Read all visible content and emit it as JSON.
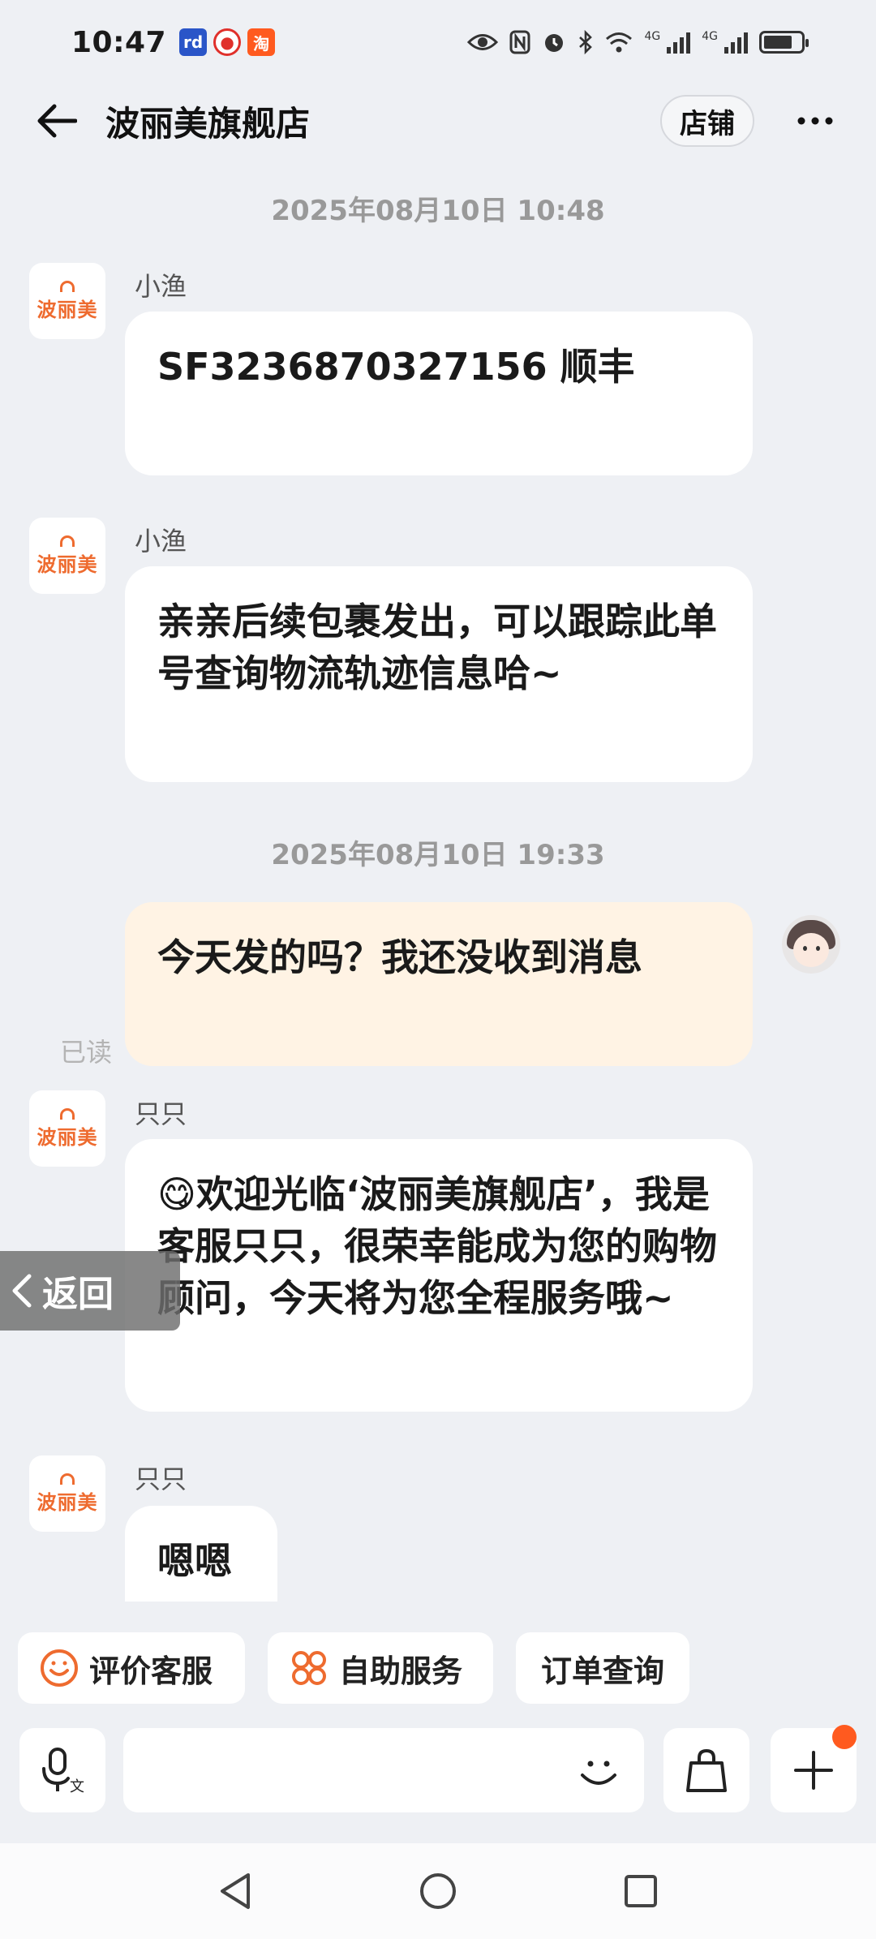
{
  "status_bar": {
    "time": "10:47",
    "notif_icons": [
      "app-notif-icon",
      "weibo-icon",
      "taobao-icon"
    ],
    "notif_texts": [
      "rd",
      "",
      "淘"
    ],
    "network_tag_1": "4G",
    "network_tag_2": "4G"
  },
  "header": {
    "title": "波丽美旗舰店",
    "store_label": "店铺"
  },
  "messages": [
    {
      "timestamp": "2025年08月10日 10:48"
    },
    {
      "sender": "小渔",
      "text": "SF3236870327156        顺丰"
    },
    {
      "sender": "小渔",
      "text": "亲亲后续包裹发出，可以跟踪此单号查询物流轨迹信息哈~"
    },
    {
      "timestamp": "2025年08月10日 19:33"
    },
    {
      "sender": "me",
      "text": "今天发的吗？我还没收到消息",
      "read": "已读"
    },
    {
      "sender": "只只",
      "text": "😋欢迎光临‘波丽美旗舰店’，我是客服只只，很荣幸能成为您的购物顾问，今天将为您全程服务哦~"
    },
    {
      "sender": "只只",
      "text": "嗯嗯"
    }
  ],
  "avatar_logo": "波丽美",
  "back_float": "返回",
  "quick_actions": [
    "评价客服",
    "自助服务",
    "订单查询"
  ],
  "colors": {
    "accent": "#ee6b2f",
    "badge": "#ff5a1f",
    "my_bubble": "#fff3e4"
  }
}
